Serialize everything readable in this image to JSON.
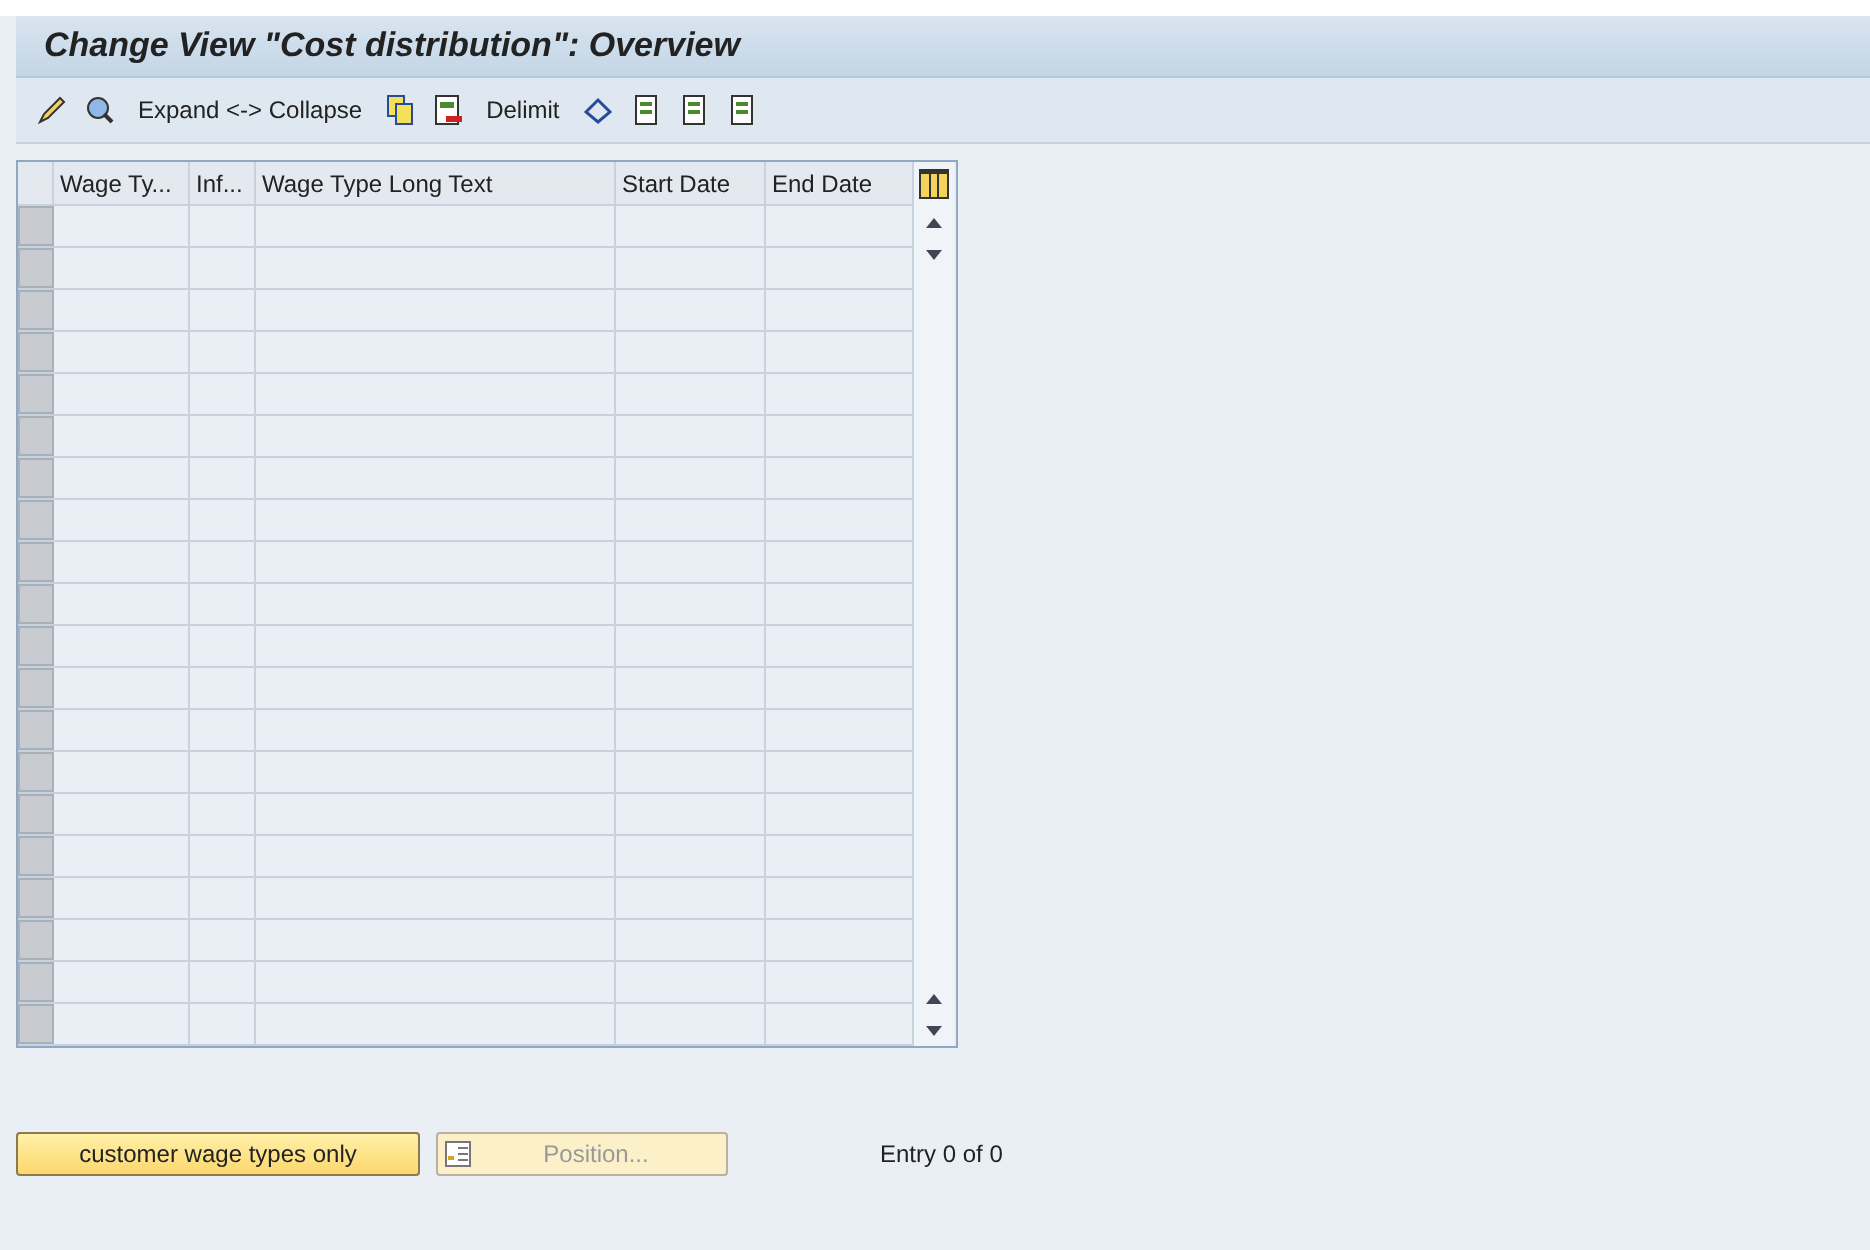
{
  "window": {
    "title": "Change View \"Cost distribution\": Overview"
  },
  "toolbar": {
    "expand_button": "Expand <-> Collapse",
    "delimit_button": "Delimit"
  },
  "table": {
    "columns": [
      "Wage Ty...",
      "Inf...",
      "Wage Type Long Text",
      "Start Date",
      "End Date"
    ]
  },
  "buttons": [
    {
      "label": "customer wage types only",
      "disabled": false
    },
    {
      "label": "Position...",
      "disabled": true
    }
  ],
  "status": "Entry 0 of 0"
}
